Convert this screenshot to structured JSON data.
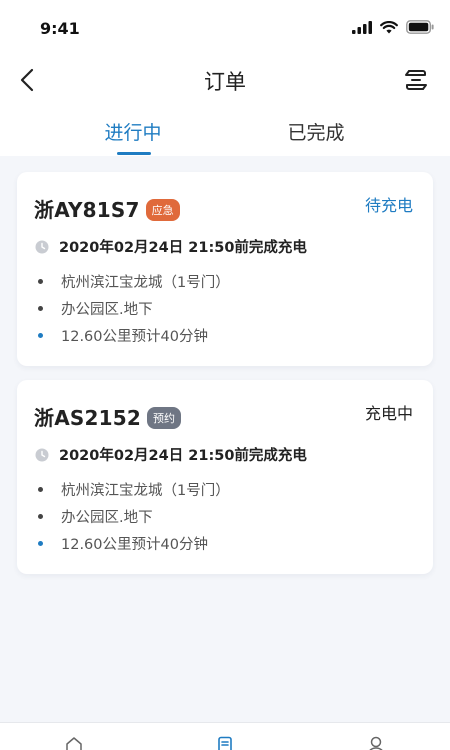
{
  "status_bar": {
    "time": "9:41"
  },
  "nav": {
    "title": "订单",
    "back_icon": "back-icon",
    "switch_icon": "switch-icon"
  },
  "tabs": [
    {
      "label": "进行中",
      "active": true
    },
    {
      "label": "已完成",
      "active": false
    }
  ],
  "orders": [
    {
      "plate": "浙AY81S7",
      "badge": "应急",
      "status": "待充电",
      "deadline": "2020年02月24日 21:50前完成充电",
      "address": "杭州滨江宝龙城（1号门）",
      "location": "办公园区.地下",
      "distance": "12.60公里预计40分钟"
    },
    {
      "plate": "浙AS2152",
      "badge": "预约",
      "status": "充电中",
      "deadline": "2020年02月24日 21:50前完成充电",
      "address": "杭州滨江宝龙城（1号门）",
      "location": "办公园区.地下",
      "distance": "12.60公里预计40分钟"
    }
  ],
  "colors": {
    "accent": "#1f7cc2",
    "urgent": "#e06a3b",
    "booked": "#6f7684",
    "background": "#f4f6fa"
  },
  "bottom_tabs": [
    {
      "icon": "home-icon"
    },
    {
      "icon": "orders-icon"
    },
    {
      "icon": "profile-icon"
    }
  ]
}
